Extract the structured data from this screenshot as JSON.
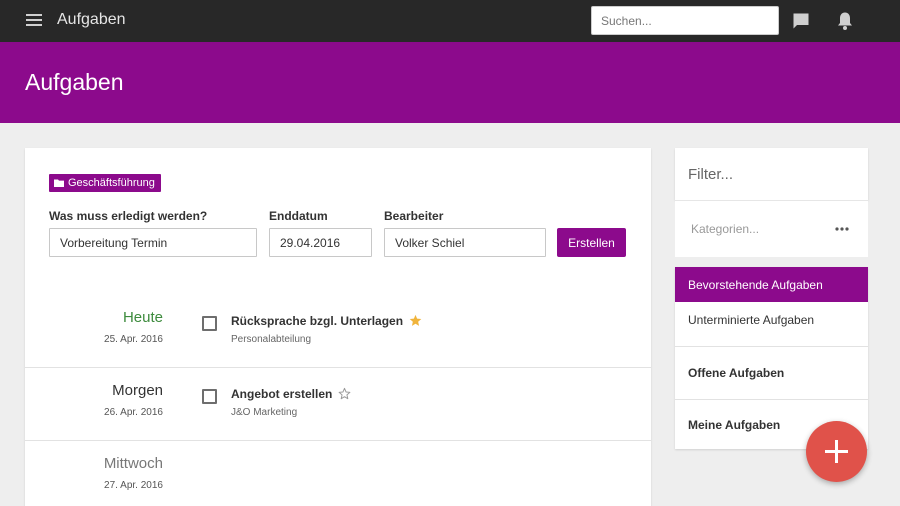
{
  "topbar": {
    "title": "Aufgaben",
    "search_placeholder": "Suchen...",
    "icons": [
      "menu-icon",
      "chat-icon",
      "bell-icon"
    ]
  },
  "header": {
    "title": "Aufgaben"
  },
  "form": {
    "category_tag": "Geschäftsführung",
    "task_label": "Was muss erledigt werden?",
    "task_value": "Vorbereitung Termin",
    "date_label": "Enddatum",
    "date_value": "29.04.2016",
    "assignee_label": "Bearbeiter",
    "assignee_value": "Volker Schiel",
    "create_label": "Erstellen"
  },
  "days": [
    {
      "name": "Heute",
      "date": "25. Apr. 2016",
      "task": {
        "title": "Rücksprache bzgl. Unterlagen",
        "subtitle": "Personalabteilung",
        "starred": true,
        "done": false
      }
    },
    {
      "name": "Morgen",
      "date": "26. Apr. 2016",
      "task": {
        "title": "Angebot erstellen",
        "subtitle": "J&O Marketing",
        "starred": false,
        "done": false
      }
    },
    {
      "name": "Mittwoch",
      "date": "27. Apr. 2016"
    }
  ],
  "sidebar": {
    "filter_placeholder": "Filter...",
    "categories_placeholder": "Kategorien...",
    "views": [
      {
        "label": "Bevorstehende Aufgaben",
        "active": true
      },
      {
        "label": "Unterminierte Aufgaben",
        "active": false
      },
      {
        "label": "Offene Aufgaben",
        "active": false
      },
      {
        "label": "Meine Aufgaben",
        "active": false
      }
    ]
  },
  "colors": {
    "brand": "#8c0a8c",
    "topbar": "#282828",
    "today": "#3d8b3d",
    "star": "#f0b43c",
    "fab": "#e0524a"
  }
}
